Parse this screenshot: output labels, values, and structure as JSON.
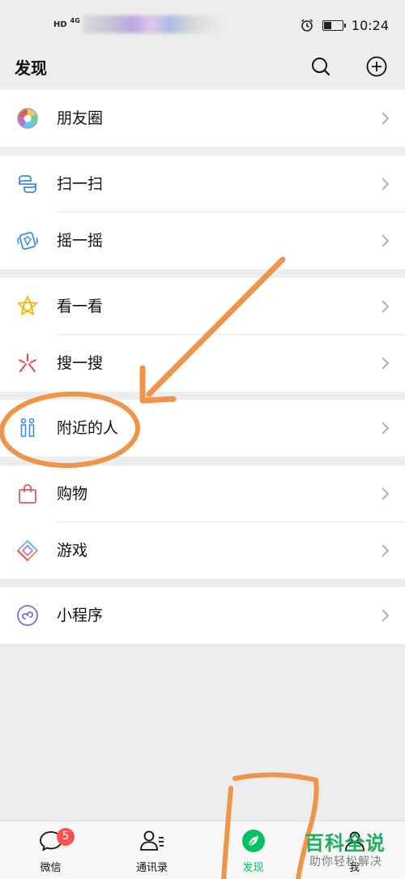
{
  "status_bar": {
    "signal_tag": "HD",
    "network_tag": "4G",
    "time": "10:24"
  },
  "header": {
    "title": "发现",
    "search_icon": "search-icon",
    "add_icon": "plus-circle-icon"
  },
  "groups": [
    {
      "items": [
        {
          "label": "朋友圈",
          "icon": "moments-icon"
        }
      ]
    },
    {
      "items": [
        {
          "label": "扫一扫",
          "icon": "scan-icon"
        },
        {
          "label": "摇一摇",
          "icon": "shake-icon"
        }
      ]
    },
    {
      "items": [
        {
          "label": "看一看",
          "icon": "top-stories-icon"
        },
        {
          "label": "搜一搜",
          "icon": "search-sparkle-icon"
        }
      ]
    },
    {
      "items": [
        {
          "label": "附近的人",
          "icon": "people-nearby-icon"
        }
      ]
    },
    {
      "items": [
        {
          "label": "购物",
          "icon": "shopping-bag-icon"
        },
        {
          "label": "游戏",
          "icon": "games-icon"
        }
      ]
    },
    {
      "items": [
        {
          "label": "小程序",
          "icon": "mini-programs-icon"
        }
      ]
    }
  ],
  "bottom_nav": {
    "items": [
      {
        "label": "微信",
        "icon": "chats-icon",
        "badge": "5"
      },
      {
        "label": "通讯录",
        "icon": "contacts-icon"
      },
      {
        "label": "发现",
        "icon": "discover-icon",
        "active": true
      },
      {
        "label": "我",
        "icon": "me-icon"
      }
    ]
  },
  "watermark": {
    "title": "百科全说",
    "subtitle": "助你轻松解决"
  },
  "colors": {
    "accent": "#07c160",
    "annotation": "#f0944a",
    "badge": "#fa5151",
    "background": "#ededed"
  }
}
